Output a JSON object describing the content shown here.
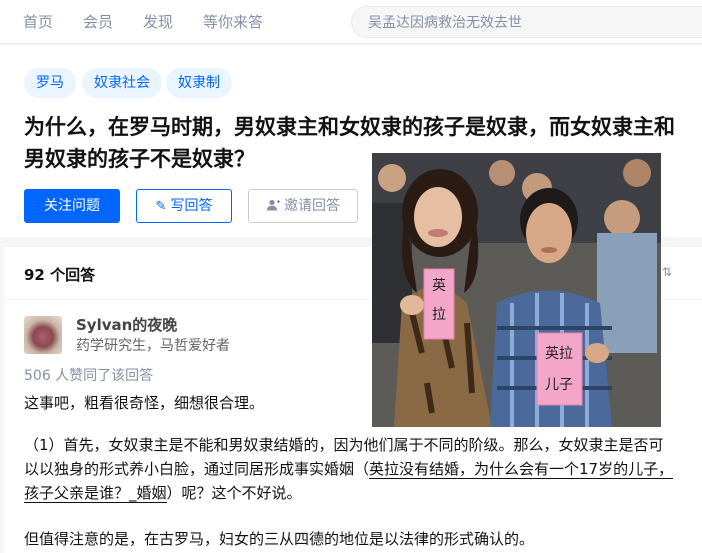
{
  "nav": {
    "items": [
      "首页",
      "会员",
      "发现",
      "等你来答"
    ],
    "search_placeholder": "吴孟达因病救治无效去世"
  },
  "question": {
    "tags": [
      "罗马",
      "奴隶社会",
      "奴隶制"
    ],
    "title": "为什么，在罗马时期，男奴隶主和女奴隶的孩子是奴隶，而女奴隶主和男奴隶的孩子不是奴隶？",
    "follow_label": "关注问题",
    "write_label": "写回答",
    "invite_label": "邀请回答"
  },
  "answers": {
    "count_label": "92 个回答",
    "author": "Sylvan的夜晚",
    "headline": "药学研究生，马哲爱好者",
    "votes": "506 人赞同了该回答",
    "p1": "这事吧，粗看很奇怪，细想很合理。",
    "p2_pre": "（1）首先，女奴隶主是不能和男奴隶结婚的，因为他们属于不同的阶级。那么，女奴隶主是否可以以独身的形式养小白脸，通过同居形成事实婚姻（",
    "p2_link": "英拉没有结婚，为什么会有一个17岁的儿子，孩子父亲是谁？_婚姻",
    "p2_post": "）呢？这个不好说。",
    "p3": "但值得注意的是，在古罗马，妇女的三从四德的地位是以法律的形式确认的。"
  },
  "photo": {
    "sign_left": [
      "英",
      "拉"
    ],
    "sign_right": [
      "英拉",
      "儿子"
    ]
  },
  "colors": {
    "brand": "#0066ff",
    "tag_bg": "#ebf5ff",
    "muted": "#8590a6"
  }
}
